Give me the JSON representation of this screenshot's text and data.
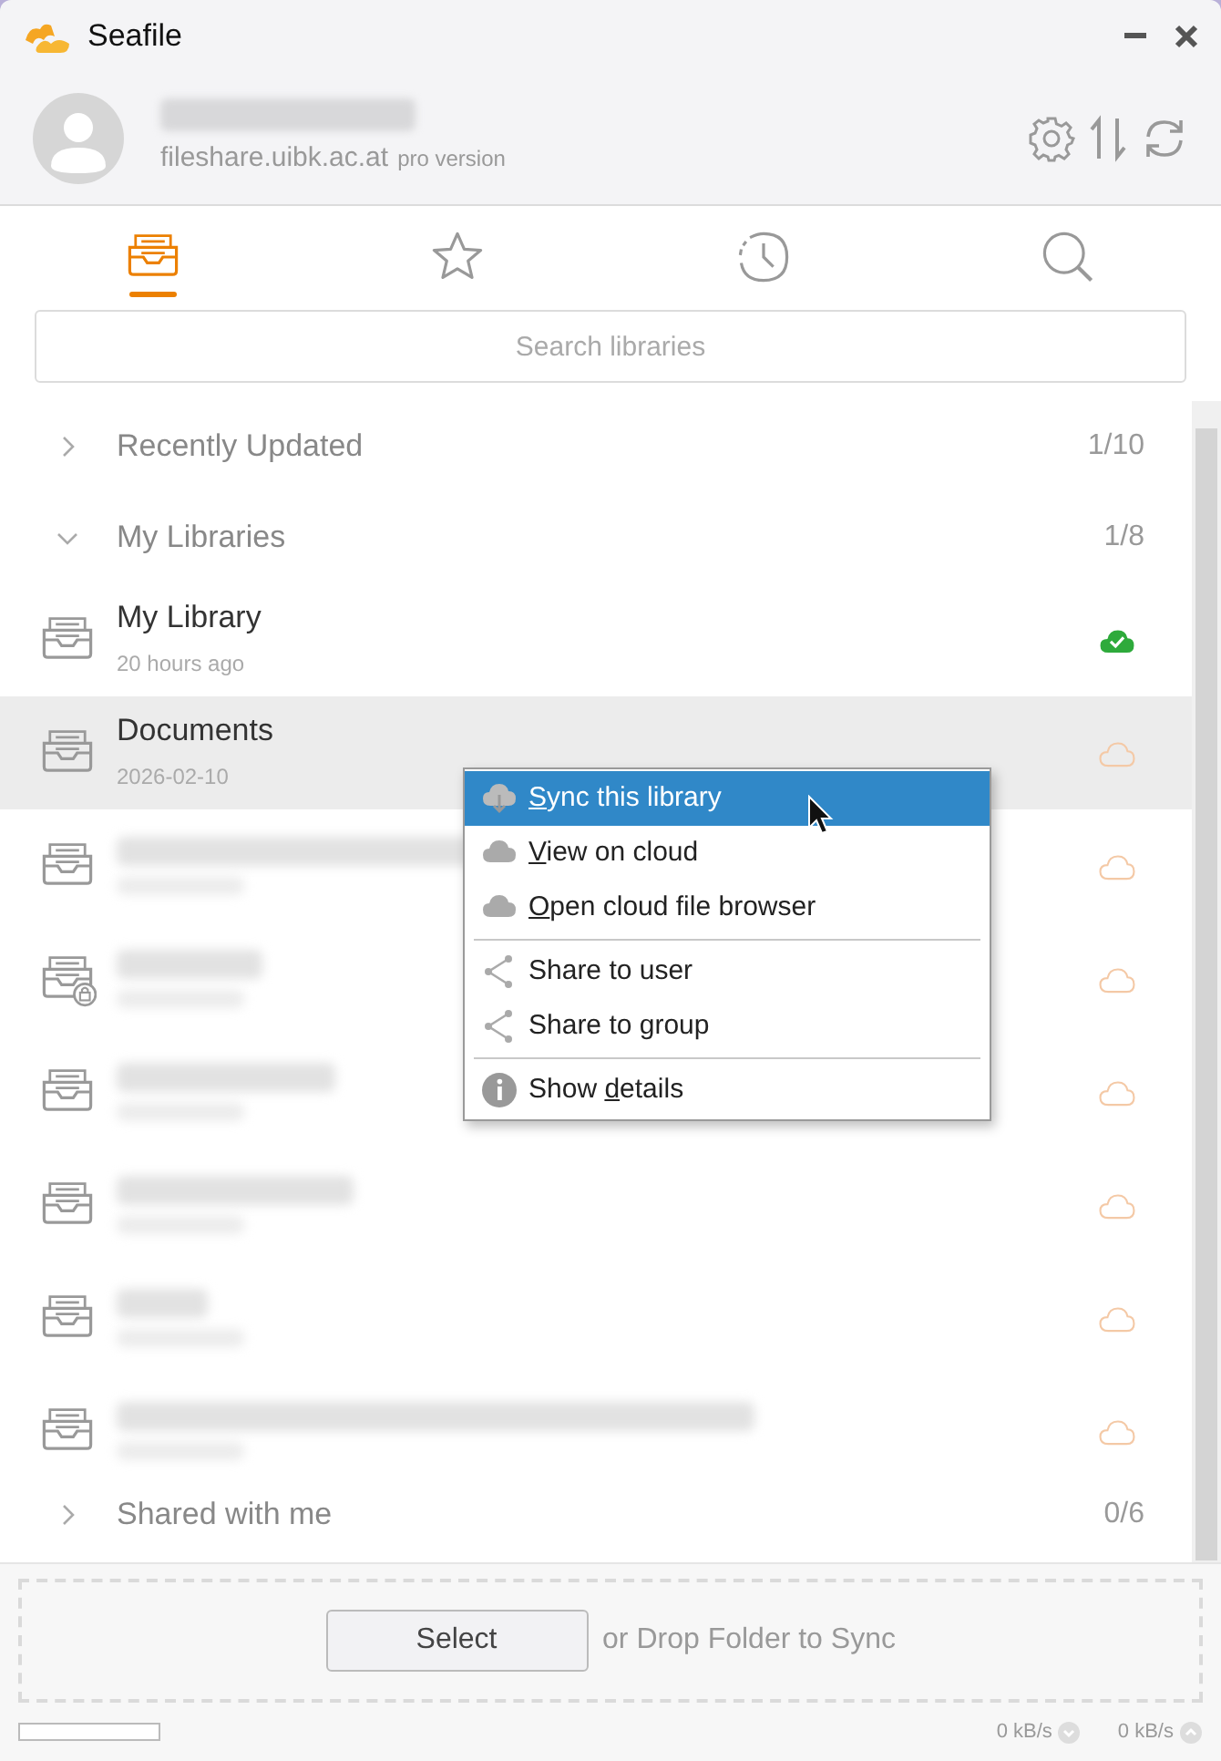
{
  "window": {
    "title": "Seafile"
  },
  "account": {
    "server": "fileshare.uibk.ac.at",
    "edition": "pro version"
  },
  "tabs": [
    {
      "kind": "libraries",
      "selected": true
    },
    {
      "kind": "starred",
      "selected": false
    },
    {
      "kind": "activity",
      "selected": false
    },
    {
      "kind": "search",
      "selected": false
    }
  ],
  "search": {
    "placeholder": "Search libraries"
  },
  "sections": [
    {
      "label": "Recently Updated",
      "count": "1/10",
      "expanded": false
    },
    {
      "label": "My Libraries",
      "count": "1/8",
      "expanded": true,
      "libraries": [
        {
          "name": "My Library",
          "updated": "20 hours ago",
          "encrypted": false,
          "synced": true,
          "selected": false
        },
        {
          "name": "Documents",
          "updated": "2026-02-10",
          "encrypted": false,
          "synced": false,
          "selected": true
        },
        {
          "encrypted": false,
          "synced": false,
          "selected": false
        },
        {
          "encrypted": true,
          "synced": false,
          "selected": false
        },
        {
          "encrypted": false,
          "synced": false,
          "selected": false
        },
        {
          "encrypted": false,
          "synced": false,
          "selected": false
        },
        {
          "encrypted": false,
          "synced": false,
          "selected": false
        },
        {
          "encrypted": false,
          "synced": false,
          "selected": false
        }
      ]
    },
    {
      "label": "Shared with me",
      "count": "0/6",
      "expanded": false
    }
  ],
  "context_menu": [
    {
      "kind": "sync",
      "key": "S",
      "after": "ync this library",
      "selected": true
    },
    {
      "kind": "cloud",
      "key": "V",
      "after": "iew on cloud",
      "selected": false
    },
    {
      "kind": "cloud",
      "key": "O",
      "after": "pen cloud file browser",
      "selected": false
    },
    {
      "kind": "separator"
    },
    {
      "kind": "share",
      "before": "Share to user",
      "selected": false
    },
    {
      "kind": "share",
      "before": "Share to group",
      "selected": false
    },
    {
      "kind": "separator"
    },
    {
      "kind": "info",
      "before": "Show ",
      "key": "d",
      "after": "etails",
      "selected": false
    }
  ],
  "drop_zone": {
    "button": "Select",
    "text": "or Drop Folder to Sync"
  },
  "status_bar": {
    "progress": {
      "level": 0
    },
    "download_rate": "0 kB/s",
    "upload_rate": "0 kB/s"
  }
}
